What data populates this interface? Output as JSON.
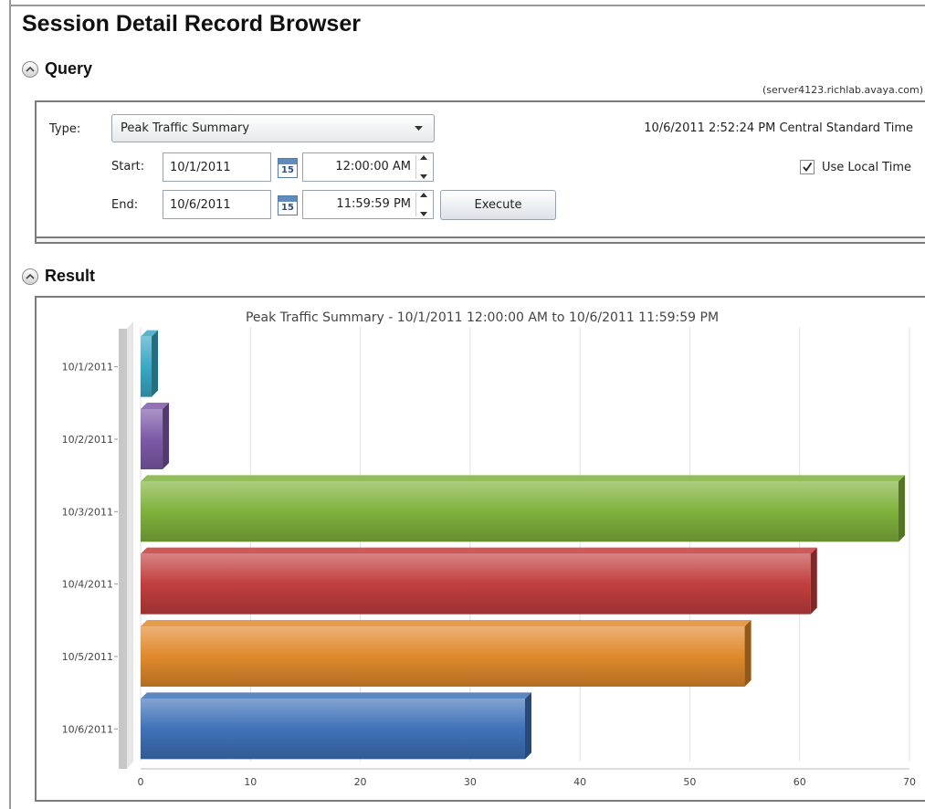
{
  "page": {
    "title": "Session Detail Record Browser"
  },
  "query": {
    "section_label": "Query",
    "server": "(server4123.richlab.avaya.com)",
    "type_label": "Type:",
    "type_value": "Peak Traffic Summary",
    "start_label": "Start:",
    "start_date": "10/1/2011",
    "start_time": "12:00:00 AM",
    "end_label": "End:",
    "end_date": "10/6/2011",
    "end_time": "11:59:59 PM",
    "calendar_day": "15",
    "execute_label": "Execute",
    "timestamp": "10/6/2011 2:52:24 PM Central Standard Time",
    "use_local_time_label": "Use Local Time",
    "use_local_time_checked": true
  },
  "result": {
    "section_label": "Result"
  },
  "chart_data": {
    "type": "bar",
    "orientation": "horizontal",
    "title": "Peak Traffic Summary - 10/1/2011 12:00:00 AM to 10/6/2011 11:59:59 PM",
    "xlabel": "",
    "ylabel": "",
    "categories": [
      "10/1/2011",
      "10/2/2011",
      "10/3/2011",
      "10/4/2011",
      "10/5/2011",
      "10/6/2011"
    ],
    "values": [
      1,
      2,
      69,
      61,
      55,
      35
    ],
    "colors": [
      "#3aa8c4",
      "#7d5aa8",
      "#7fb23c",
      "#c23e3e",
      "#e0892c",
      "#3f72b8"
    ],
    "xlim": [
      0,
      70
    ],
    "xticks": [
      0,
      10,
      20,
      30,
      40,
      50,
      60,
      70
    ],
    "grid": true,
    "legend": "none"
  }
}
